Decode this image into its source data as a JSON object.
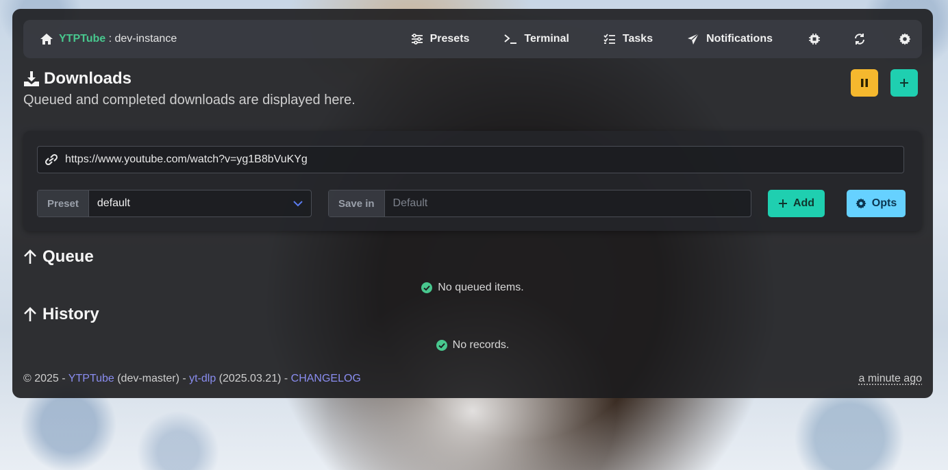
{
  "navbar": {
    "brand_name": "YTPTube",
    "brand_separator": " : ",
    "instance": "dev-instance",
    "items": [
      {
        "label": "Presets",
        "icon": "sliders-icon"
      },
      {
        "label": "Terminal",
        "icon": "terminal-icon"
      },
      {
        "label": "Tasks",
        "icon": "tasks-icon"
      },
      {
        "label": "Notifications",
        "icon": "paper-plane-icon"
      }
    ],
    "icon_buttons": [
      "cpu-icon",
      "refresh-icon",
      "gear-icon"
    ]
  },
  "page": {
    "title": "Downloads",
    "subtitle": "Queued and completed downloads are displayed here."
  },
  "form": {
    "url_value": "https://www.youtube.com/watch?v=yg1B8bVuKYg",
    "preset_label": "Preset",
    "preset_value": "default",
    "save_in_label": "Save in",
    "save_in_placeholder": "Default",
    "add_label": "Add",
    "opts_label": "Opts"
  },
  "queue": {
    "title": "Queue",
    "empty": "No queued items."
  },
  "history": {
    "title": "History",
    "empty": "No records."
  },
  "footer": {
    "copyright": "© 2025 - ",
    "app_link": "YTPTube",
    "app_version": " (dev-master) - ",
    "ytdlp_link": "yt-dlp",
    "ytdlp_version": " (2025.03.21) - ",
    "changelog_link": "CHANGELOG",
    "updated": "a minute ago"
  },
  "colors": {
    "brand": "#48c78e",
    "pause_button": "#f5b82e",
    "primary": "#1fcfb0",
    "info": "#66d1ff",
    "link": "#8a8df0"
  }
}
